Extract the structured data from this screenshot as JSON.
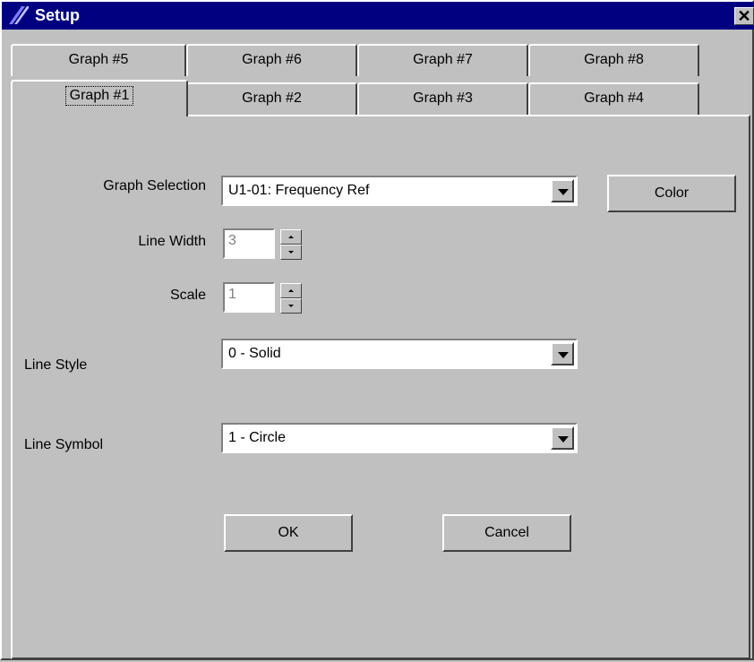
{
  "window": {
    "title": "Setup"
  },
  "tabs": {
    "row_back": [
      "Graph #5",
      "Graph #6",
      "Graph #7",
      "Graph #8"
    ],
    "row_front": [
      "Graph #1",
      "Graph #2",
      "Graph #3",
      "Graph #4"
    ],
    "active": "Graph #1"
  },
  "form": {
    "graph_selection": {
      "label": "Graph Selection",
      "value": "U1-01: Frequency Ref"
    },
    "color_button": "Color",
    "line_width": {
      "label": "Line Width",
      "value": "3"
    },
    "scale": {
      "label": "Scale",
      "value": "1"
    },
    "line_style": {
      "label": "Line Style",
      "value": "0 - Solid"
    },
    "line_symbol": {
      "label": "Line Symbol",
      "value": "1 - Circle"
    },
    "ok_button": "OK",
    "cancel_button": "Cancel"
  },
  "icons": {
    "app": "app-icon",
    "close": "close-icon",
    "dropdown": "chevron-down-icon"
  },
  "colors": {
    "titlebar": "#000080",
    "face": "#c0c0c0",
    "field": "#ffffff",
    "disabled_text": "#808080"
  }
}
